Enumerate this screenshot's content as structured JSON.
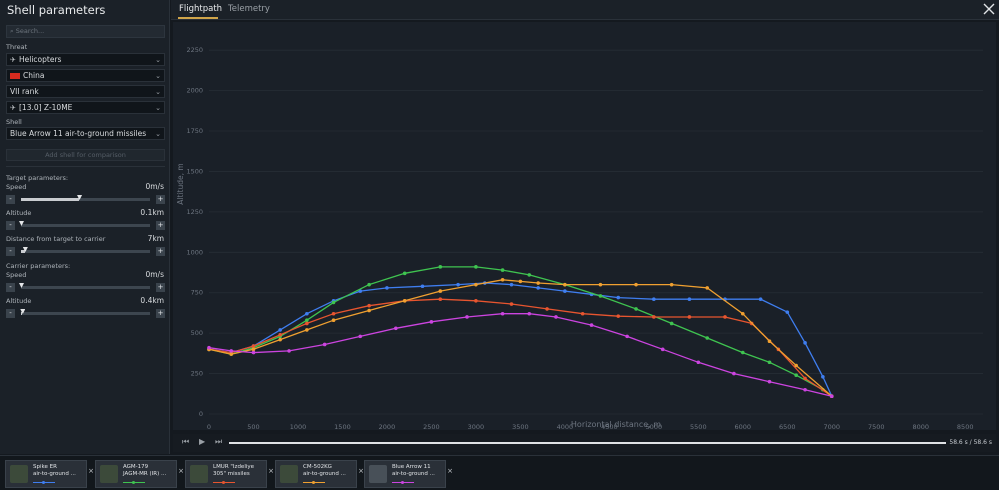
{
  "sidebar": {
    "title": "Shell parameters",
    "search_placeholder": "Search...",
    "threat_label": "Threat",
    "threat_class": "Helicopters",
    "country": "China",
    "rank": "VII rank",
    "vehicle": "[13.0] Z-10ME",
    "shell_label": "Shell",
    "shell": "Blue Arrow 11 air-to-ground missiles",
    "add_shell": "Add shell for comparison",
    "target_params_label": "Target parameters:",
    "target_speed_label": "Speed",
    "target_speed_value": "0m/s",
    "target_speed_fraction": 0.45,
    "target_altitude_label": "Altitude",
    "target_altitude_value": "0.1km",
    "target_altitude_fraction": 0.0,
    "distance_label": "Distance from target to carrier",
    "distance_value": "7km",
    "distance_fraction": 0.03,
    "carrier_params_label": "Carrier parameters:",
    "carrier_speed_label": "Speed",
    "carrier_speed_value": "0m/s",
    "carrier_speed_fraction": 0.0,
    "carrier_altitude_label": "Altitude",
    "carrier_altitude_value": "0.4km",
    "carrier_altitude_fraction": 0.01,
    "minus": "-",
    "plus": "+"
  },
  "tabs": [
    "Flightpath",
    "Telemetry"
  ],
  "playback": {
    "time": "58.6 s  /  58.6 s",
    "progress": 1.0
  },
  "cards": [
    {
      "name_line1": "Spike ER",
      "name_line2": "air-to-ground ...",
      "color": "#3f7ef0",
      "icon": "tank-icon"
    },
    {
      "name_line1": "AGM-179",
      "name_line2": "JAGM-MR (IR) ...",
      "color": "#3fc450",
      "icon": "tank-icon"
    },
    {
      "name_line1": "LMUR \"Izdeliye",
      "name_line2": "305\" missiles",
      "color": "#e8552f",
      "icon": "tank-icon"
    },
    {
      "name_line1": "CM-502KG",
      "name_line2": "air-to-ground ...",
      "color": "#f0a030",
      "icon": "tank-icon"
    },
    {
      "name_line1": "Blue Arrow 11",
      "name_line2": "air-to-ground ...",
      "color": "#cc44e0",
      "icon": "helicopter-icon"
    }
  ],
  "chart_data": {
    "type": "line",
    "xlabel": "Horizontal distance, m",
    "ylabel": "Altitude, m",
    "xlim": [
      0,
      8700
    ],
    "ylim": [
      0,
      2350
    ],
    "xticks": [
      0,
      500,
      1000,
      1500,
      2000,
      2500,
      3000,
      3500,
      4000,
      4500,
      5000,
      5500,
      6000,
      6500,
      7000,
      7500,
      8000,
      8500
    ],
    "yticks": [
      0,
      250,
      500,
      750,
      1000,
      1250,
      1500,
      1750,
      2000,
      2250
    ],
    "series": [
      {
        "name": "Spike ER",
        "color": "#3f7ef0",
        "x": [
          0,
          250,
          500,
          800,
          1100,
          1400,
          1700,
          2000,
          2400,
          2800,
          3100,
          3400,
          3700,
          4000,
          4300,
          4600,
          5000,
          5400,
          5800,
          6200,
          6500,
          6700,
          6900,
          7000
        ],
        "y": [
          400,
          380,
          420,
          520,
          620,
          700,
          760,
          780,
          790,
          800,
          810,
          800,
          780,
          760,
          740,
          720,
          710,
          710,
          710,
          710,
          630,
          440,
          230,
          110
        ]
      },
      {
        "name": "AGM-179 JAGM-MR (IR)",
        "color": "#3fc450",
        "x": [
          0,
          250,
          500,
          800,
          1100,
          1400,
          1800,
          2200,
          2600,
          3000,
          3300,
          3600,
          4000,
          4400,
          4800,
          5200,
          5600,
          6000,
          6300,
          6600,
          6900,
          7000
        ],
        "y": [
          400,
          370,
          410,
          480,
          580,
          690,
          800,
          870,
          910,
          910,
          890,
          860,
          800,
          730,
          650,
          560,
          470,
          380,
          320,
          240,
          150,
          110
        ]
      },
      {
        "name": "LMUR \"Izdeliye 305\" missiles",
        "color": "#e8552f",
        "x": [
          0,
          250,
          500,
          800,
          1100,
          1400,
          1800,
          2200,
          2600,
          3000,
          3400,
          3800,
          4200,
          4600,
          5000,
          5400,
          5800,
          6100,
          6400,
          6700,
          7000
        ],
        "y": [
          400,
          380,
          420,
          490,
          560,
          620,
          670,
          700,
          710,
          700,
          680,
          650,
          620,
          605,
          600,
          600,
          600,
          560,
          400,
          220,
          110
        ]
      },
      {
        "name": "CM-502KG",
        "color": "#f0a030",
        "x": [
          0,
          250,
          500,
          800,
          1100,
          1400,
          1800,
          2200,
          2600,
          3000,
          3300,
          3500,
          3700,
          4000,
          4400,
          4800,
          5200,
          5600,
          6000,
          6300,
          6600,
          7000
        ],
        "y": [
          400,
          370,
          400,
          460,
          520,
          580,
          640,
          700,
          760,
          800,
          830,
          820,
          810,
          800,
          800,
          800,
          800,
          780,
          620,
          450,
          300,
          110
        ]
      },
      {
        "name": "Blue Arrow 11",
        "color": "#cc44e0",
        "x": [
          0,
          250,
          500,
          900,
          1300,
          1700,
          2100,
          2500,
          2900,
          3300,
          3600,
          3900,
          4300,
          4700,
          5100,
          5500,
          5900,
          6300,
          6700,
          7000
        ],
        "y": [
          410,
          390,
          380,
          390,
          430,
          480,
          530,
          570,
          600,
          620,
          620,
          600,
          550,
          480,
          400,
          320,
          250,
          200,
          150,
          110
        ]
      }
    ]
  }
}
